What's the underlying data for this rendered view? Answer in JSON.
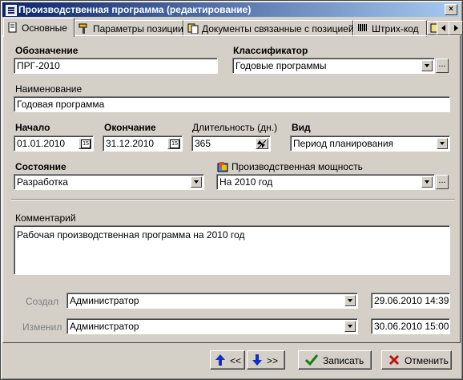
{
  "window": {
    "title": "Производственная программа (редактирование)",
    "close_glyph": "×"
  },
  "tabs": [
    {
      "label": "Основные",
      "icon": "page-icon",
      "active": true
    },
    {
      "label": "Параметры позиции",
      "icon": "hammer-icon"
    },
    {
      "label": "Документы связанные с позицией",
      "icon": "documents-icon"
    },
    {
      "label": "Штрих-код",
      "icon": "barcode-icon"
    }
  ],
  "form": {
    "designation": {
      "label": "Обозначение",
      "value": "ПРГ-2010"
    },
    "classifier": {
      "label": "Классификатор",
      "value": "Годовые программы"
    },
    "name": {
      "label": "Наименование",
      "value": "Годовая программа"
    },
    "start": {
      "label": "Начало",
      "value": "01.01.2010"
    },
    "end": {
      "label": "Окончание",
      "value": "31.12.2010"
    },
    "duration": {
      "label": "Длительность (дн.)",
      "value": "365"
    },
    "kind": {
      "label": "Вид",
      "value": "Период планирования"
    },
    "state": {
      "label": "Состояние",
      "value": "Разработка"
    },
    "capacity": {
      "label": "Производственная мощность",
      "value": "На 2010 год"
    },
    "comment": {
      "label": "Комментарий",
      "value": "Рабочая производственная программа на 2010 год"
    },
    "created": {
      "label": "Создал",
      "user": "Администратор",
      "date": "29.06.2010 14:39"
    },
    "changed": {
      "label": "Изменил",
      "user": "Администратор",
      "date": "30.06.2010 15:00"
    },
    "calendar_day": "15",
    "ellipsis": "..."
  },
  "buttons": {
    "prev": "<<",
    "next": ">>",
    "save": "Записать",
    "cancel": "Отменить"
  }
}
